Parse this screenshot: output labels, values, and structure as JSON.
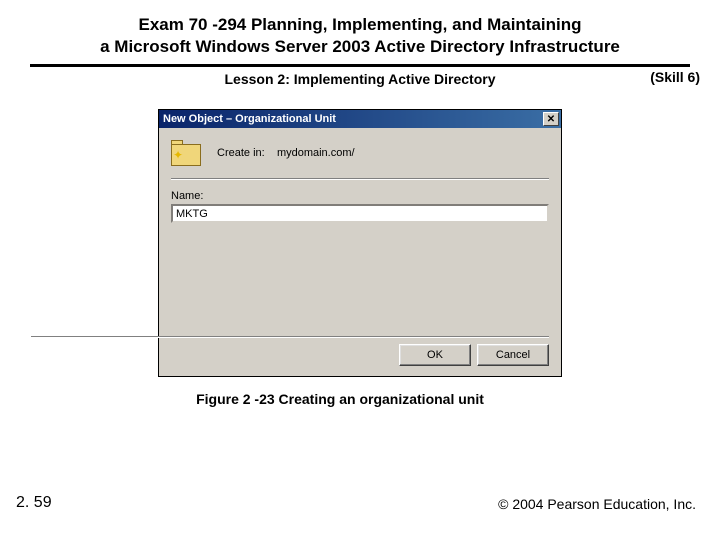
{
  "header": {
    "title_line1": "Exam 70 -294 Planning, Implementing, and Maintaining",
    "title_line2": "a Microsoft Windows Server 2003 Active Directory Infrastructure",
    "lesson": "Lesson 2: Implementing Active Directory",
    "skill": "(Skill 6)"
  },
  "dialog": {
    "title": "New Object – Organizational Unit",
    "close_glyph": "✕",
    "create_in_label": "Create in:",
    "create_in_value": "mydomain.com/",
    "name_label": "Name:",
    "name_value": "MKTG",
    "ok": "OK",
    "cancel": "Cancel"
  },
  "caption": "Figure 2 -23 Creating an organizational unit",
  "footer": {
    "page": "2. 59",
    "copyright": "© 2004 Pearson Education, Inc."
  }
}
